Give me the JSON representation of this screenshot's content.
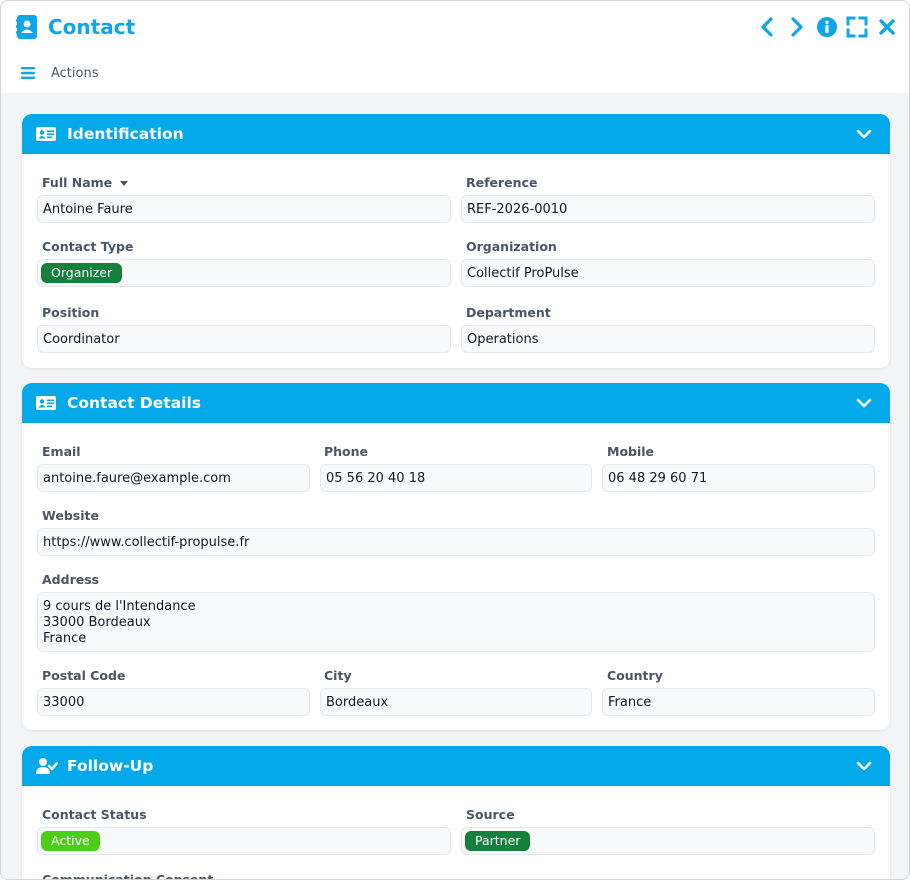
{
  "window": {
    "title": "Contact",
    "actions_label": "Actions",
    "controls": [
      "chevron-left-icon",
      "chevron-right-icon",
      "info-icon",
      "expand-icon",
      "close-icon"
    ],
    "accent": "#0ea5e9"
  },
  "identification": {
    "title": "Identification",
    "full_name_label": "Full Name",
    "full_name": "Antoine Faure",
    "reference_label": "Reference",
    "reference": "REF-2026-0010",
    "contact_type_label": "Contact Type",
    "contact_type": "Organizer",
    "contact_type_color": "#15803d",
    "organization_label": "Organization",
    "organization": "Collectif ProPulse",
    "position_label": "Position",
    "position": "Coordinator",
    "department_label": "Department",
    "department": "Operations"
  },
  "contact_details": {
    "title": "Contact Details",
    "email_label": "Email",
    "email": "antoine.faure@example.com",
    "phone_label": "Phone",
    "phone": "05 56 20 40 18",
    "mobile_label": "Mobile",
    "mobile": "06 48 29 60 71",
    "website_label": "Website",
    "website": "https://www.collectif-propulse.fr",
    "address_label": "Address",
    "address": "9 cours de l'Intendance\n33000 Bordeaux\nFrance",
    "postal_code_label": "Postal Code",
    "postal_code": "33000",
    "city_label": "City",
    "city": "Bordeaux",
    "country_label": "Country",
    "country": "France"
  },
  "follow_up": {
    "title": "Follow-Up",
    "contact_status_label": "Contact Status",
    "contact_status": "Active",
    "contact_status_color": "#4ccd16",
    "source_label": "Source",
    "source": "Partner",
    "source_color": "#15803d",
    "communication_consent_label": "Communication Consent"
  }
}
